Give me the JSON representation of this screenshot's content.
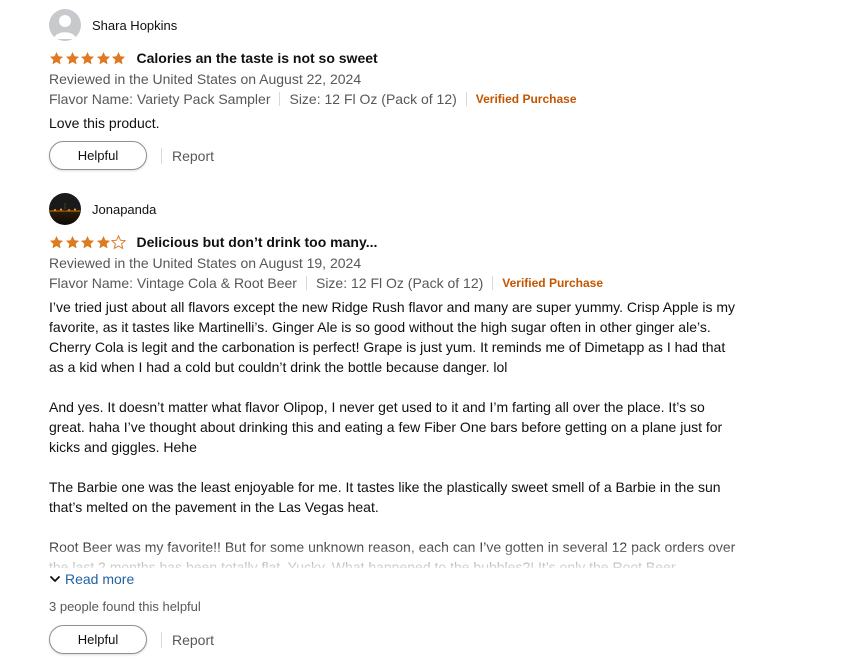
{
  "reviews": [
    {
      "author": "Shara Hopkins",
      "rating": 5,
      "title": "Calories an the taste is not so sweet",
      "date_line": "Reviewed in the United States on August 22, 2024",
      "flavor": "Flavor Name: Variety Pack Sampler",
      "size": "Size: 12 Fl Oz (Pack of 12)",
      "verified": "Verified Purchase",
      "paragraphs": [
        "Love this product."
      ],
      "helpful_label": "Helpful",
      "report_label": "Report"
    },
    {
      "author": "Jonapanda",
      "rating": 4,
      "title": "Delicious but don’t drink too many...",
      "date_line": "Reviewed in the United States on August 19, 2024",
      "flavor": "Flavor Name: Vintage Cola & Root Beer",
      "size": "Size: 12 Fl Oz (Pack of 12)",
      "verified": "Verified Purchase",
      "paragraphs": [
        "I’ve tried just about all flavors except the new Ridge Rush flavor and many are super yummy. Crisp Apple is my favorite, as it tastes like Martinelli’s. Ginger Ale is so good without the high sugar often in other ginger ale’s. Cherry Cola is legit and the carbonation is perfect! Grape is just yum. It reminds me of Dimetapp as I had that as a kid when I had a cold but couldn’t drink the bottle because danger. lol",
        "And yes. It doesn’t matter what flavor Olipop, I never get used to it and I’m farting all over the place. It’s so great. haha I’ve thought about drinking this and eating a few Fiber One bars before getting on a plane just for kicks and giggles. Hehe",
        "The Barbie one was the least enjoyable for me. It tastes like the plastically sweet smell of a Barbie in the sun that’s melted on the pavement in the Las Vegas heat.",
        "Root Beer was my favorite!! But for some unknown reason, each can I’ve gotten in several 12 pack orders over the last 2 months has been totally flat. Yucky. What happened to the bubbles?! It’s only the Root Beer"
      ],
      "read_more": "Read more",
      "helpful_count": "3 people found this helpful",
      "helpful_label": "Helpful",
      "report_label": "Report"
    }
  ],
  "colors": {
    "star": "#de7921",
    "verified": "#c45500",
    "link": "#2162a1",
    "muted": "#565959"
  },
  "icons": {
    "default_avatar": "person-silhouette-icon",
    "star_full": "star-filled-icon",
    "star_empty": "star-outline-icon",
    "read_more": "chevron-down-icon"
  }
}
